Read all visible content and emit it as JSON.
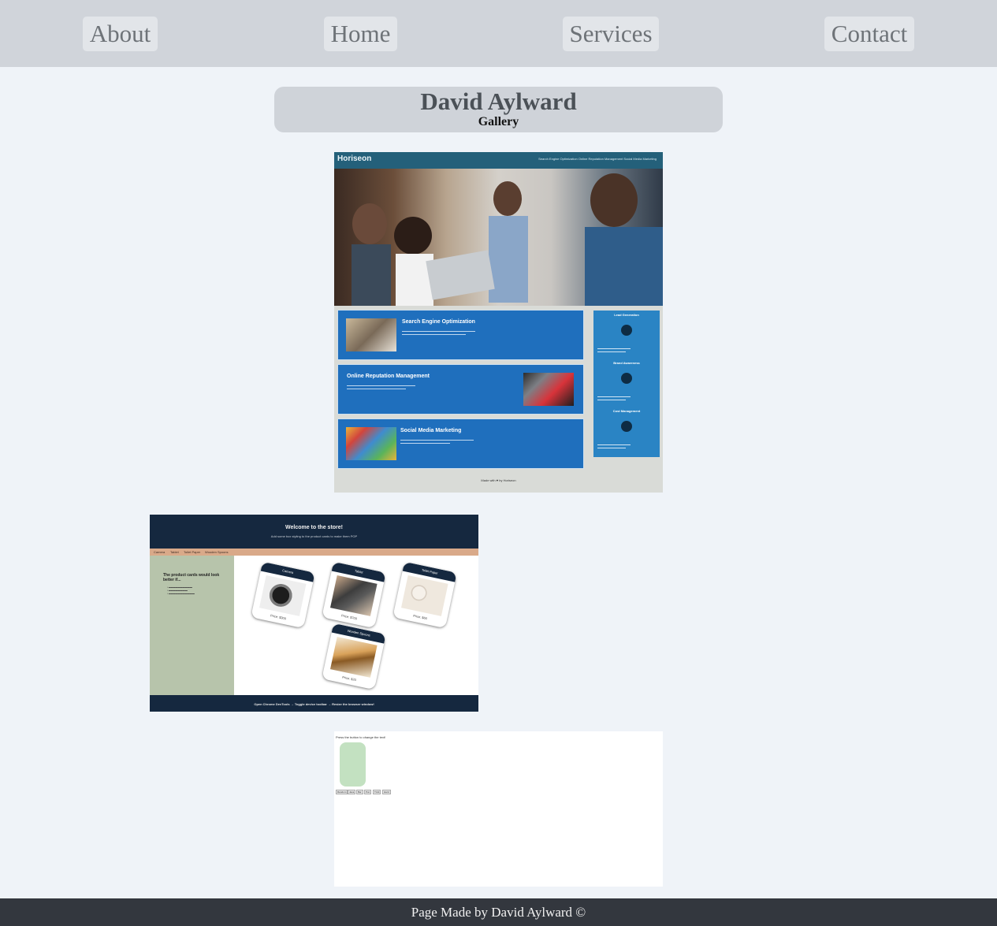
{
  "nav": {
    "items": [
      "About",
      "Home",
      "Services",
      "Contact"
    ]
  },
  "header": {
    "name": "David Aylward",
    "subtitle": "Gallery"
  },
  "gallery": {
    "horiseon": {
      "logo": "Horiseon",
      "links": "Search Engine Optimization  Online Reputation Management  Social Media Marketing",
      "cards": [
        "Search Engine Optimization",
        "Online Reputation Management",
        "Social Media Marketing"
      ],
      "side_titles": [
        "Lead Generation",
        "Brand Awareness",
        "Cost Management"
      ],
      "footer": "Made with ♥ by Horiseon"
    },
    "store": {
      "title": "Welcome to the store!",
      "subtitle": "Add some box styling to the product cards to make them POP",
      "nav": [
        "Camera",
        "Tablet",
        "Toilet Paper",
        "Wooden Spoons"
      ],
      "sidebar_title": "The product cards would look better if...",
      "products": [
        {
          "name": "Camera",
          "price": "Price: $300"
        },
        {
          "name": "Tablet",
          "price": "Price: $700"
        },
        {
          "name": "Toilet Paper",
          "price": "Price: $60"
        },
        {
          "name": "Wooden Spoons",
          "price": "Price: $20"
        }
      ],
      "footer": "Open Chrome DevTools → Toggle device toolbar → Resize the browser window!"
    },
    "joke": {
      "question": "Press the button to change the text!",
      "tabs": [
        "Random",
        "Java",
        "Bar",
        "Pun",
        "Trick",
        "Hard"
      ]
    }
  },
  "footer": {
    "text": "Page Made by David Aylward ©"
  }
}
